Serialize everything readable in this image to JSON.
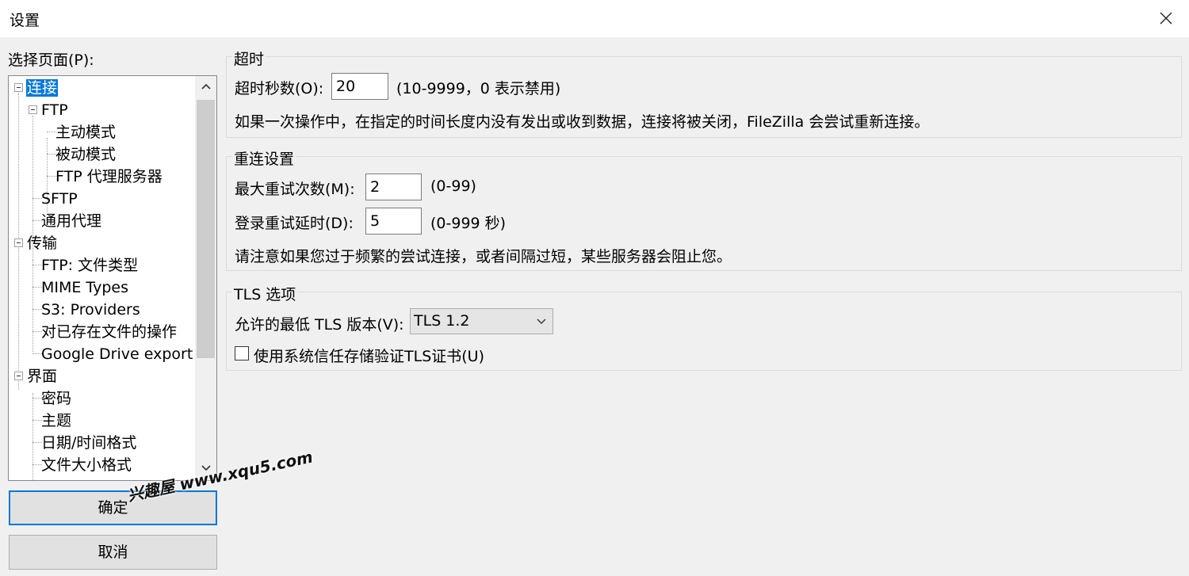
{
  "window": {
    "title": "设置",
    "close_icon": "close-icon"
  },
  "tree": {
    "label": "选择页面(P):",
    "items": [
      {
        "label": "连接",
        "selected": true
      },
      {
        "label": "FTP"
      },
      {
        "label": "主动模式"
      },
      {
        "label": "被动模式"
      },
      {
        "label": "FTP 代理服务器"
      },
      {
        "label": "SFTP"
      },
      {
        "label": "通用代理"
      },
      {
        "label": "传输"
      },
      {
        "label": "FTP: 文件类型"
      },
      {
        "label": "MIME Types"
      },
      {
        "label": "S3: Providers"
      },
      {
        "label": "对已存在文件的操作"
      },
      {
        "label": "Google Drive export"
      },
      {
        "label": "界面"
      },
      {
        "label": "密码"
      },
      {
        "label": "主题"
      },
      {
        "label": "日期/时间格式"
      },
      {
        "label": "文件大小格式"
      }
    ]
  },
  "buttons": {
    "ok": "确定",
    "cancel": "取消"
  },
  "timeout": {
    "title": "超时",
    "seconds_label": "超时秒数(O):",
    "seconds_value": "20",
    "range_hint": "(10-9999，0 表示禁用)",
    "description": "如果一次操作中，在指定的时间长度内没有发出或收到数据，连接将被关闭，FileZilla 会尝试重新连接。"
  },
  "reconnect": {
    "title": "重连设置",
    "retries_label": "最大重试次数(M):",
    "retries_value": "2",
    "retries_hint": "(0-99)",
    "delay_label": "登录重试延时(D):",
    "delay_value": "5",
    "delay_hint": "(0-999 秒)",
    "note": "请注意如果您过于频繁的尝试连接，或者间隔过短，某些服务器会阻止您。"
  },
  "tls": {
    "title": "TLS 选项",
    "min_version_label": "允许的最低 TLS 版本(V):",
    "min_version_value": "TLS 1.2",
    "system_trust_label": "使用系统信任存储验证TLS证书(U)",
    "system_trust_checked": false
  },
  "watermark": "兴趣屋 www.xqu5.com"
}
